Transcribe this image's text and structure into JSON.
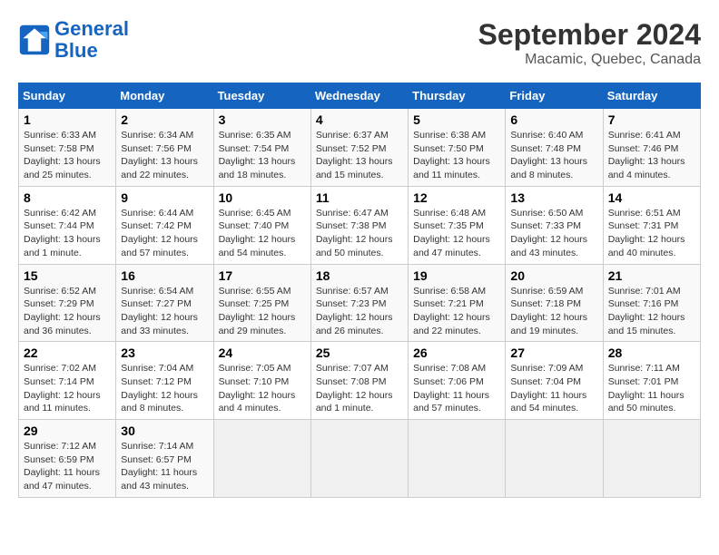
{
  "header": {
    "logo_line1": "General",
    "logo_line2": "Blue",
    "month": "September 2024",
    "location": "Macamic, Quebec, Canada"
  },
  "days_of_week": [
    "Sunday",
    "Monday",
    "Tuesday",
    "Wednesday",
    "Thursday",
    "Friday",
    "Saturday"
  ],
  "weeks": [
    [
      {
        "day": "1",
        "sunrise": "6:33 AM",
        "sunset": "7:58 PM",
        "daylight": "13 hours and 25 minutes."
      },
      {
        "day": "2",
        "sunrise": "6:34 AM",
        "sunset": "7:56 PM",
        "daylight": "13 hours and 22 minutes."
      },
      {
        "day": "3",
        "sunrise": "6:35 AM",
        "sunset": "7:54 PM",
        "daylight": "13 hours and 18 minutes."
      },
      {
        "day": "4",
        "sunrise": "6:37 AM",
        "sunset": "7:52 PM",
        "daylight": "13 hours and 15 minutes."
      },
      {
        "day": "5",
        "sunrise": "6:38 AM",
        "sunset": "7:50 PM",
        "daylight": "13 hours and 11 minutes."
      },
      {
        "day": "6",
        "sunrise": "6:40 AM",
        "sunset": "7:48 PM",
        "daylight": "13 hours and 8 minutes."
      },
      {
        "day": "7",
        "sunrise": "6:41 AM",
        "sunset": "7:46 PM",
        "daylight": "13 hours and 4 minutes."
      }
    ],
    [
      {
        "day": "8",
        "sunrise": "6:42 AM",
        "sunset": "7:44 PM",
        "daylight": "13 hours and 1 minute."
      },
      {
        "day": "9",
        "sunrise": "6:44 AM",
        "sunset": "7:42 PM",
        "daylight": "12 hours and 57 minutes."
      },
      {
        "day": "10",
        "sunrise": "6:45 AM",
        "sunset": "7:40 PM",
        "daylight": "12 hours and 54 minutes."
      },
      {
        "day": "11",
        "sunrise": "6:47 AM",
        "sunset": "7:38 PM",
        "daylight": "12 hours and 50 minutes."
      },
      {
        "day": "12",
        "sunrise": "6:48 AM",
        "sunset": "7:35 PM",
        "daylight": "12 hours and 47 minutes."
      },
      {
        "day": "13",
        "sunrise": "6:50 AM",
        "sunset": "7:33 PM",
        "daylight": "12 hours and 43 minutes."
      },
      {
        "day": "14",
        "sunrise": "6:51 AM",
        "sunset": "7:31 PM",
        "daylight": "12 hours and 40 minutes."
      }
    ],
    [
      {
        "day": "15",
        "sunrise": "6:52 AM",
        "sunset": "7:29 PM",
        "daylight": "12 hours and 36 minutes."
      },
      {
        "day": "16",
        "sunrise": "6:54 AM",
        "sunset": "7:27 PM",
        "daylight": "12 hours and 33 minutes."
      },
      {
        "day": "17",
        "sunrise": "6:55 AM",
        "sunset": "7:25 PM",
        "daylight": "12 hours and 29 minutes."
      },
      {
        "day": "18",
        "sunrise": "6:57 AM",
        "sunset": "7:23 PM",
        "daylight": "12 hours and 26 minutes."
      },
      {
        "day": "19",
        "sunrise": "6:58 AM",
        "sunset": "7:21 PM",
        "daylight": "12 hours and 22 minutes."
      },
      {
        "day": "20",
        "sunrise": "6:59 AM",
        "sunset": "7:18 PM",
        "daylight": "12 hours and 19 minutes."
      },
      {
        "day": "21",
        "sunrise": "7:01 AM",
        "sunset": "7:16 PM",
        "daylight": "12 hours and 15 minutes."
      }
    ],
    [
      {
        "day": "22",
        "sunrise": "7:02 AM",
        "sunset": "7:14 PM",
        "daylight": "12 hours and 11 minutes."
      },
      {
        "day": "23",
        "sunrise": "7:04 AM",
        "sunset": "7:12 PM",
        "daylight": "12 hours and 8 minutes."
      },
      {
        "day": "24",
        "sunrise": "7:05 AM",
        "sunset": "7:10 PM",
        "daylight": "12 hours and 4 minutes."
      },
      {
        "day": "25",
        "sunrise": "7:07 AM",
        "sunset": "7:08 PM",
        "daylight": "12 hours and 1 minute."
      },
      {
        "day": "26",
        "sunrise": "7:08 AM",
        "sunset": "7:06 PM",
        "daylight": "11 hours and 57 minutes."
      },
      {
        "day": "27",
        "sunrise": "7:09 AM",
        "sunset": "7:04 PM",
        "daylight": "11 hours and 54 minutes."
      },
      {
        "day": "28",
        "sunrise": "7:11 AM",
        "sunset": "7:01 PM",
        "daylight": "11 hours and 50 minutes."
      }
    ],
    [
      {
        "day": "29",
        "sunrise": "7:12 AM",
        "sunset": "6:59 PM",
        "daylight": "11 hours and 47 minutes."
      },
      {
        "day": "30",
        "sunrise": "7:14 AM",
        "sunset": "6:57 PM",
        "daylight": "11 hours and 43 minutes."
      },
      null,
      null,
      null,
      null,
      null
    ]
  ]
}
